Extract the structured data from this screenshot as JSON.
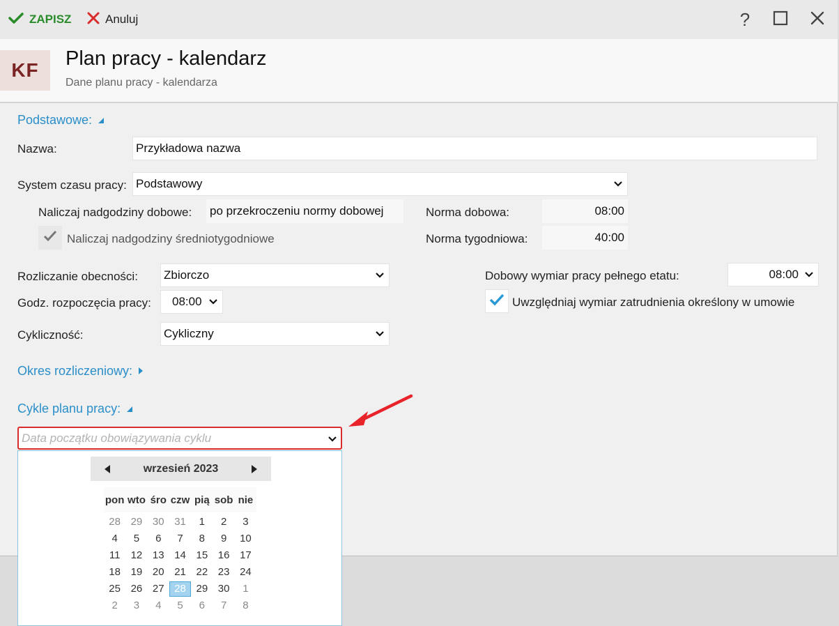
{
  "toolbar": {
    "save_label": "ZAPISZ",
    "cancel_label": "Anuluj",
    "help_label": "?"
  },
  "header": {
    "logo": "KF",
    "title": "Plan pracy - kalendarz",
    "subtitle": "Dane planu pracy - kalendarza"
  },
  "basic": {
    "section_label": "Podstawowe:",
    "name_label": "Nazwa:",
    "name_value": "Przykładowa nazwa",
    "system_label": "System czasu pracy:",
    "system_value": "Podstawowy",
    "daily_ot_label": "Naliczaj nadgodziny dobowe:",
    "daily_ot_value": "po przekroczeniu normy dobowej",
    "weekly_ot_label": "Naliczaj nadgodziny średniotygodniowe",
    "daily_norm_label": "Norma dobowa:",
    "daily_norm_value": "08:00",
    "weekly_norm_label": "Norma tygodniowa:",
    "weekly_norm_value": "40:00",
    "attendance_label": "Rozliczanie obecności:",
    "attendance_value": "Zbiorczo",
    "start_label": "Godz. rozpoczęcia pracy:",
    "start_value": "08:00",
    "cyclic_label": "Cykliczność:",
    "cyclic_value": "Cykliczny",
    "fulltime_label": "Dobowy wymiar pracy pełnego etatu:",
    "fulltime_value": "08:00",
    "employment_label": "Uwzględniaj wymiar zatrudnienia określony w umowie"
  },
  "settlement": {
    "section_label": "Okres rozliczeniowy:"
  },
  "cycles": {
    "section_label": "Cykle planu pracy:",
    "date_placeholder": "Data początku obowiązywania cyklu"
  },
  "calendar": {
    "month": "wrzesień 2023",
    "weekdays": [
      "pon",
      "wto",
      "śro",
      "czw",
      "pią",
      "sob",
      "nie"
    ],
    "weeks": [
      [
        "28",
        "29",
        "30",
        "31",
        "1",
        "2",
        "3"
      ],
      [
        "4",
        "5",
        "6",
        "7",
        "8",
        "9",
        "10"
      ],
      [
        "11",
        "12",
        "13",
        "14",
        "15",
        "16",
        "17"
      ],
      [
        "18",
        "19",
        "20",
        "21",
        "22",
        "23",
        "24"
      ],
      [
        "25",
        "26",
        "27",
        "28",
        "29",
        "30",
        "1"
      ],
      [
        "2",
        "3",
        "4",
        "5",
        "6",
        "7",
        "8"
      ]
    ],
    "selected": "28"
  },
  "colors": {
    "accent": "#2a8fc9",
    "save": "#2a8b2a",
    "cancel": "#d92b2b",
    "highlight": "#d92b2b"
  }
}
